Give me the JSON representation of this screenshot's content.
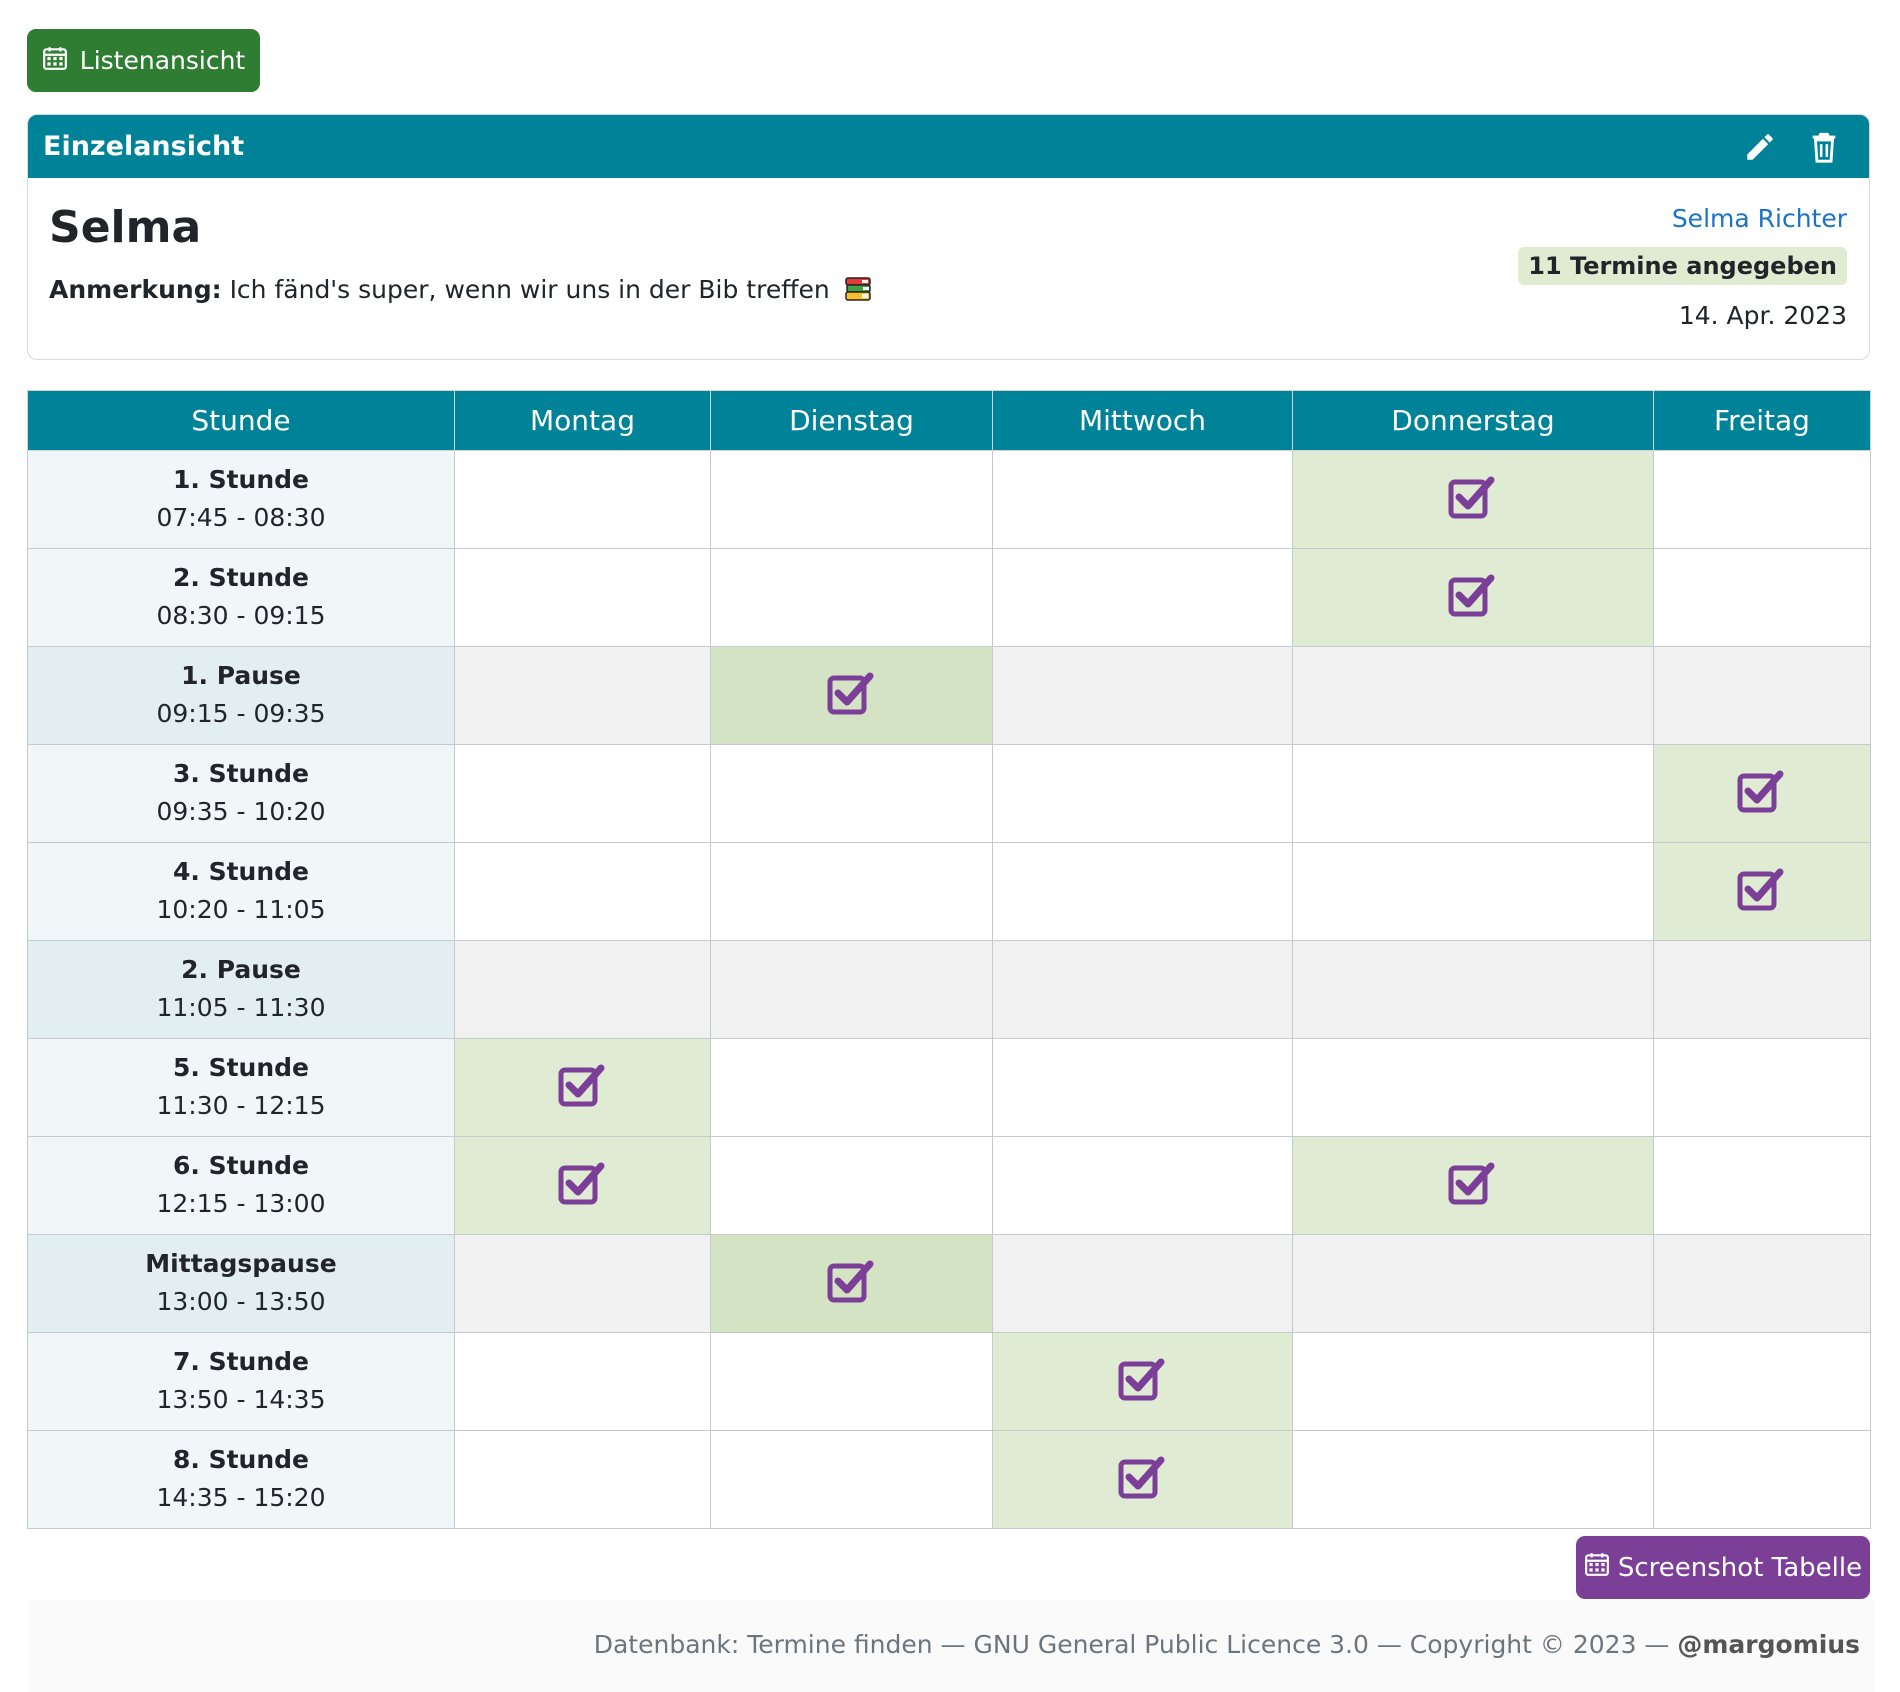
{
  "toolbar": {
    "list_view_label": "Listenansicht"
  },
  "card": {
    "title": "Einzelansicht",
    "name": "Selma",
    "note_label": "Anmerkung:",
    "note_text": "Ich fänd's super, wenn wir uns in der Bib treffen",
    "author": "Selma Richter",
    "badge": "11 Termine angegeben",
    "date": "14. Apr. 2023"
  },
  "table": {
    "headers": [
      "Stunde",
      "Montag",
      "Dienstag",
      "Mittwoch",
      "Donnerstag",
      "Freitag"
    ],
    "rows": [
      {
        "name": "1. Stunde",
        "time": "07:45 - 08:30",
        "pause": false,
        "checked": [
          false,
          false,
          false,
          true,
          false
        ]
      },
      {
        "name": "2. Stunde",
        "time": "08:30 - 09:15",
        "pause": false,
        "checked": [
          false,
          false,
          false,
          true,
          false
        ]
      },
      {
        "name": "1. Pause",
        "time": "09:15 - 09:35",
        "pause": true,
        "checked": [
          false,
          true,
          false,
          false,
          false
        ]
      },
      {
        "name": "3. Stunde",
        "time": "09:35 - 10:20",
        "pause": false,
        "checked": [
          false,
          false,
          false,
          false,
          true
        ]
      },
      {
        "name": "4. Stunde",
        "time": "10:20 - 11:05",
        "pause": false,
        "checked": [
          false,
          false,
          false,
          false,
          true
        ]
      },
      {
        "name": "2. Pause",
        "time": "11:05 - 11:30",
        "pause": true,
        "checked": [
          false,
          false,
          false,
          false,
          false
        ]
      },
      {
        "name": "5. Stunde",
        "time": "11:30 - 12:15",
        "pause": false,
        "checked": [
          true,
          false,
          false,
          false,
          false
        ]
      },
      {
        "name": "6. Stunde",
        "time": "12:15 - 13:00",
        "pause": false,
        "checked": [
          true,
          false,
          false,
          true,
          false
        ]
      },
      {
        "name": "Mittagspause",
        "time": "13:00 - 13:50",
        "pause": true,
        "checked": [
          false,
          true,
          false,
          false,
          false
        ]
      },
      {
        "name": "7. Stunde",
        "time": "13:50 - 14:35",
        "pause": false,
        "checked": [
          false,
          false,
          true,
          false,
          false
        ]
      },
      {
        "name": "8. Stunde",
        "time": "14:35 - 15:20",
        "pause": false,
        "checked": [
          false,
          false,
          true,
          false,
          false
        ]
      }
    ]
  },
  "actions": {
    "screenshot_label": "Screenshot Tabelle"
  },
  "footer": {
    "text": "Datenbank: Termine finden — GNU General Public Licence 3.0 — Copyright © 2023 —",
    "handle": "@margomius"
  },
  "colors": {
    "header_teal": "#008298",
    "green_button": "#2e7d32",
    "purple": "#7b3f98",
    "checked_bg": "#e0ebd3"
  },
  "icons": [
    "calendar-icon",
    "pencil-icon",
    "trash-icon",
    "books-icon",
    "checkbox-checked-icon"
  ]
}
